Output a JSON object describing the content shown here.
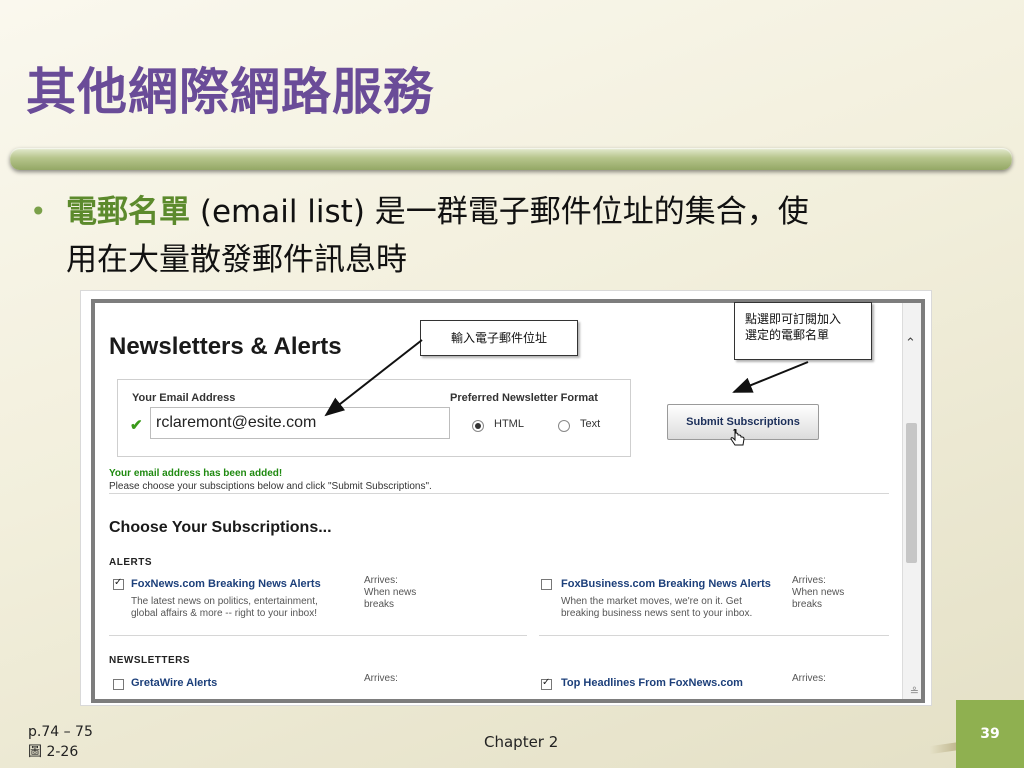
{
  "slide": {
    "title": "其他網際網路服務",
    "bullet_term": "電郵名單",
    "bullet_text_1": " (email list) 是一群電子郵件位址的集合，使",
    "bullet_text_2": "用在大量散發郵件訊息時"
  },
  "screenshot": {
    "heading": "Newsletters & Alerts",
    "email_label": "Your Email Address",
    "email_value": "rclaremont@esite.com",
    "format_label": "Preferred Newsletter Format",
    "format_options": [
      "HTML",
      "Text"
    ],
    "format_selected": "HTML",
    "submit_label": "Submit Subscriptions",
    "confirm_message": "Your email address has been added!",
    "instruction": "Please choose your subsciptions below and click \"Submit Subscriptions\".",
    "choose_heading": "Choose Your Subscriptions...",
    "alerts_label": "ALERTS",
    "newsletters_label": "NEWSLETTERS",
    "alerts": [
      {
        "title": "FoxNews.com Breaking News Alerts",
        "desc_1": "The latest news on politics, entertainment,",
        "desc_2": "global affairs & more -- right to your inbox!",
        "arrives_label": "Arrives:",
        "arrives_1": "When news",
        "arrives_2": "breaks",
        "checked": true
      },
      {
        "title": "FoxBusiness.com Breaking News Alerts",
        "desc_1": "When the market moves, we're on it. Get",
        "desc_2": "breaking business news sent to your inbox.",
        "arrives_label": "Arrives:",
        "arrives_1": "When news",
        "arrives_2": "breaks",
        "checked": false
      }
    ],
    "newsletters": [
      {
        "title": "GretaWire Alerts",
        "arrives_label": "Arrives:",
        "checked": false
      },
      {
        "title": "Top Headlines From FoxNews.com",
        "arrives_label": "Arrives:",
        "checked": true
      }
    ]
  },
  "callouts": {
    "email_note": "輸入電子郵件位址",
    "submit_note_1": "點選即可訂閱加入",
    "submit_note_2": "選定的電郵名單"
  },
  "footer": {
    "page_ref": "p.74 – 75",
    "figure_ref": "圖 2-26",
    "chapter": "Chapter 2",
    "page_number": "39"
  },
  "colors": {
    "title": "#6a4c98",
    "term": "#5c8a2c",
    "badge": "#8fb050"
  }
}
